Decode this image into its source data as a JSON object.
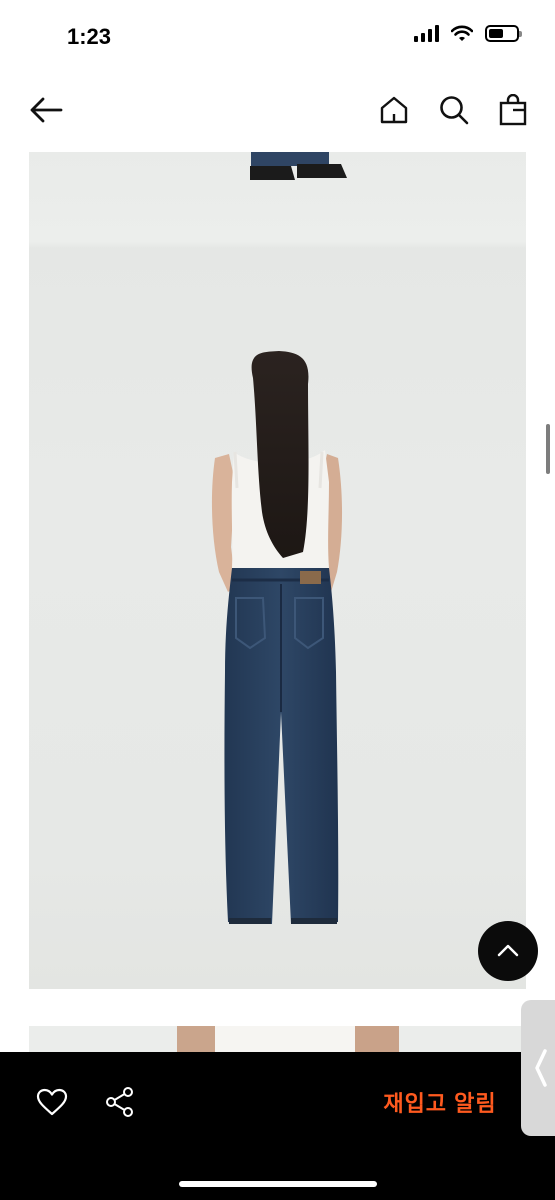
{
  "status_bar": {
    "time": "1:23"
  },
  "icons": {
    "back": "arrow-left-icon",
    "home": "home-icon",
    "search": "search-icon",
    "bag": "shopping-bag-icon",
    "scroll_top": "chevron-up-icon",
    "wishlist": "heart-icon",
    "share": "share-icon",
    "side_tab": "chevron-left-icon"
  },
  "colors": {
    "accent": "#ff5a1f",
    "bottom_bar": "#000000"
  },
  "bottom_bar": {
    "restock_label": "재입고 알림"
  }
}
